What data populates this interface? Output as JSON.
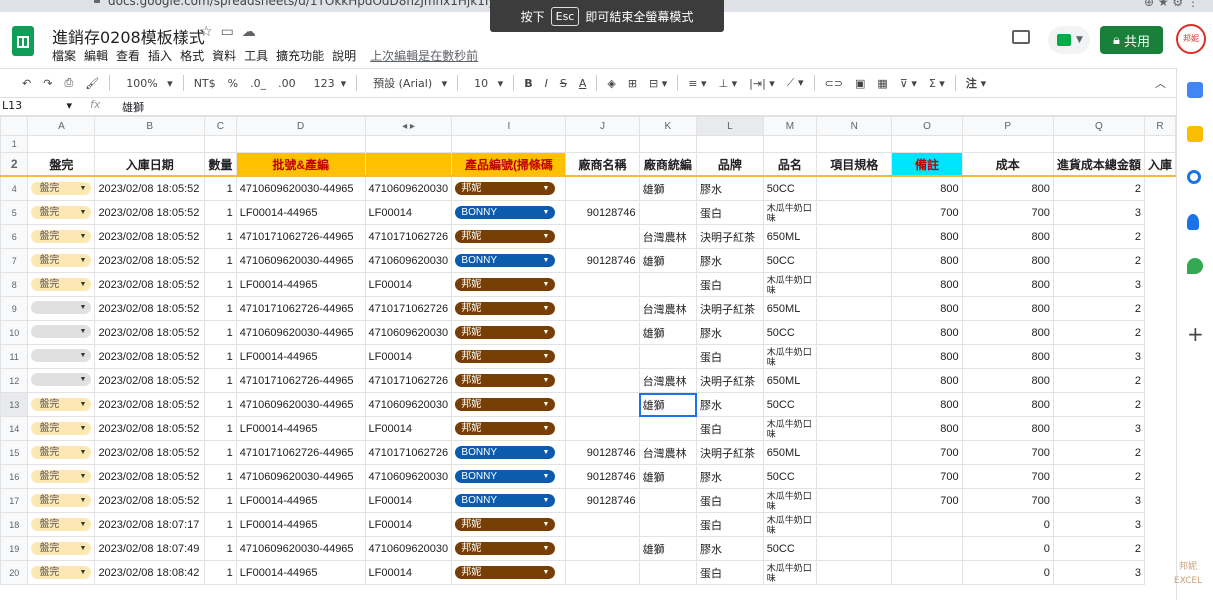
{
  "browser": {
    "url": "docs.google.com/spreadsheets/d/1TOkkHpdOdD8nzJmhx1Hjk1IyAz1yHd5KIsh0"
  },
  "toast": {
    "prefix": "按下",
    "key": "Esc",
    "suffix": "即可結束全螢幕模式"
  },
  "doc": {
    "title": "進銷存0208模板樣式",
    "menus": [
      "檔案",
      "編輯",
      "查看",
      "插入",
      "格式",
      "資料",
      "工具",
      "擴充功能",
      "說明"
    ],
    "last_edit": "上次編輯是在數秒前",
    "share_label": "共用",
    "avatar_text": "邦妮"
  },
  "toolbar": {
    "zoom": "100%",
    "currency": "NT$",
    "percent": "%",
    "dec_less": ".0_",
    "dec_more": ".00",
    "format_more": "123",
    "font": "預設 (Arial)",
    "font_size": "10"
  },
  "formula_bar": {
    "cell": "L13",
    "fx": "fx",
    "value": "雄獅"
  },
  "columns": [
    "A",
    "B",
    "C",
    "D",
    "◂ ▸",
    "I",
    "J",
    "K",
    "L",
    "M",
    "N",
    "O",
    "P",
    "Q",
    "R"
  ],
  "header_row": [
    "盤完",
    "入庫日期",
    "數量",
    "批號&產編",
    "產品編號(掃條碼",
    "廠商名稱",
    "廠商統編",
    "品牌",
    "品名",
    "項目規格",
    "備註",
    "成本",
    "進貨成本總金額",
    "入庫"
  ],
  "rows": [
    {
      "n": "4",
      "status": "盤完",
      "date": "2023/02/08 18:05:52",
      "qty": "1",
      "batch": "4710609620030-44965",
      "code": "4710609620030",
      "vendor": "邦妮",
      "vcolor": "brown",
      "tax": "",
      "brand": "雄獅",
      "name": "膠水",
      "spec": "50CC",
      "cost": "800",
      "total": "800",
      "in": "2"
    },
    {
      "n": "5",
      "status": "盤完",
      "date": "2023/02/08 18:05:52",
      "qty": "1",
      "batch": "LF00014-44965",
      "code": "LF00014",
      "vendor": "BONNY",
      "vcolor": "blue",
      "tax": "90128746",
      "brand": "",
      "name": "蛋白",
      "spec": "木瓜牛奶口味",
      "cost": "700",
      "total": "700",
      "in": "3"
    },
    {
      "n": "6",
      "status": "盤完",
      "date": "2023/02/08 18:05:52",
      "qty": "1",
      "batch": "4710171062726-44965",
      "code": "4710171062726",
      "vendor": "邦妮",
      "vcolor": "brown",
      "tax": "",
      "brand": "台灣農林",
      "name": "決明子紅茶",
      "spec": "650ML",
      "cost": "800",
      "total": "800",
      "in": "2"
    },
    {
      "n": "7",
      "status": "盤完",
      "date": "2023/02/08 18:05:52",
      "qty": "1",
      "batch": "4710609620030-44965",
      "code": "4710609620030",
      "vendor": "BONNY",
      "vcolor": "blue",
      "tax": "90128746",
      "brand": "雄獅",
      "name": "膠水",
      "spec": "50CC",
      "cost": "800",
      "total": "800",
      "in": "2"
    },
    {
      "n": "8",
      "status": "盤完",
      "date": "2023/02/08 18:05:52",
      "qty": "1",
      "batch": "LF00014-44965",
      "code": "LF00014",
      "vendor": "邦妮",
      "vcolor": "brown",
      "tax": "",
      "brand": "",
      "name": "蛋白",
      "spec": "木瓜牛奶口味",
      "cost": "800",
      "total": "800",
      "in": "3"
    },
    {
      "n": "9",
      "status": "",
      "date": "2023/02/08 18:05:52",
      "qty": "1",
      "batch": "4710171062726-44965",
      "code": "4710171062726",
      "vendor": "邦妮",
      "vcolor": "brown",
      "tax": "",
      "brand": "台灣農林",
      "name": "決明子紅茶",
      "spec": "650ML",
      "cost": "800",
      "total": "800",
      "in": "2"
    },
    {
      "n": "10",
      "status": "",
      "date": "2023/02/08 18:05:52",
      "qty": "1",
      "batch": "4710609620030-44965",
      "code": "4710609620030",
      "vendor": "邦妮",
      "vcolor": "brown",
      "tax": "",
      "brand": "雄獅",
      "name": "膠水",
      "spec": "50CC",
      "cost": "800",
      "total": "800",
      "in": "2"
    },
    {
      "n": "11",
      "status": "",
      "date": "2023/02/08 18:05:52",
      "qty": "1",
      "batch": "LF00014-44965",
      "code": "LF00014",
      "vendor": "邦妮",
      "vcolor": "brown",
      "tax": "",
      "brand": "",
      "name": "蛋白",
      "spec": "木瓜牛奶口味",
      "cost": "800",
      "total": "800",
      "in": "3"
    },
    {
      "n": "12",
      "status": "",
      "date": "2023/02/08 18:05:52",
      "qty": "1",
      "batch": "4710171062726-44965",
      "code": "4710171062726",
      "vendor": "邦妮",
      "vcolor": "brown",
      "tax": "",
      "brand": "台灣農林",
      "name": "決明子紅茶",
      "spec": "650ML",
      "cost": "800",
      "total": "800",
      "in": "2"
    },
    {
      "n": "13",
      "status": "盤完",
      "date": "2023/02/08 18:05:52",
      "qty": "1",
      "batch": "4710609620030-44965",
      "code": "4710609620030",
      "vendor": "邦妮",
      "vcolor": "brown",
      "tax": "",
      "brand": "雄獅",
      "name": "膠水",
      "spec": "50CC",
      "cost": "800",
      "total": "800",
      "in": "2"
    },
    {
      "n": "14",
      "status": "盤完",
      "date": "2023/02/08 18:05:52",
      "qty": "1",
      "batch": "LF00014-44965",
      "code": "LF00014",
      "vendor": "邦妮",
      "vcolor": "brown",
      "tax": "",
      "brand": "",
      "name": "蛋白",
      "spec": "木瓜牛奶口味",
      "cost": "800",
      "total": "800",
      "in": "3"
    },
    {
      "n": "15",
      "status": "盤完",
      "date": "2023/02/08 18:05:52",
      "qty": "1",
      "batch": "4710171062726-44965",
      "code": "4710171062726",
      "vendor": "BONNY",
      "vcolor": "blue",
      "tax": "90128746",
      "brand": "台灣農林",
      "name": "決明子紅茶",
      "spec": "650ML",
      "cost": "700",
      "total": "700",
      "in": "2"
    },
    {
      "n": "16",
      "status": "盤完",
      "date": "2023/02/08 18:05:52",
      "qty": "1",
      "batch": "4710609620030-44965",
      "code": "4710609620030",
      "vendor": "BONNY",
      "vcolor": "blue",
      "tax": "90128746",
      "brand": "雄獅",
      "name": "膠水",
      "spec": "50CC",
      "cost": "700",
      "total": "700",
      "in": "2"
    },
    {
      "n": "17",
      "status": "盤完",
      "date": "2023/02/08 18:05:52",
      "qty": "1",
      "batch": "LF00014-44965",
      "code": "LF00014",
      "vendor": "BONNY",
      "vcolor": "blue",
      "tax": "90128746",
      "brand": "",
      "name": "蛋白",
      "spec": "木瓜牛奶口味",
      "cost": "700",
      "total": "700",
      "in": "3"
    },
    {
      "n": "18",
      "status": "盤完",
      "date": "2023/02/08 18:07:17",
      "qty": "1",
      "batch": "LF00014-44965",
      "code": "LF00014",
      "vendor": "邦妮",
      "vcolor": "brown",
      "tax": "",
      "brand": "",
      "name": "蛋白",
      "spec": "木瓜牛奶口味",
      "cost": "",
      "total": "0",
      "in": "3"
    },
    {
      "n": "19",
      "status": "盤完",
      "date": "2023/02/08 18:07:49",
      "qty": "1",
      "batch": "4710609620030-44965",
      "code": "4710609620030",
      "vendor": "邦妮",
      "vcolor": "brown",
      "tax": "",
      "brand": "雄獅",
      "name": "膠水",
      "spec": "50CC",
      "cost": "",
      "total": "0",
      "in": "2"
    },
    {
      "n": "20",
      "status": "盤完",
      "date": "2023/02/08 18:08:42",
      "qty": "1",
      "batch": "LF00014-44965",
      "code": "LF00014",
      "vendor": "邦妮",
      "vcolor": "brown",
      "tax": "",
      "brand": "",
      "name": "蛋白",
      "spec": "木瓜牛奶口味",
      "cost": "",
      "total": "0",
      "in": "3"
    }
  ],
  "selected_row": "13",
  "watermark": "邦妮 EXCEL"
}
